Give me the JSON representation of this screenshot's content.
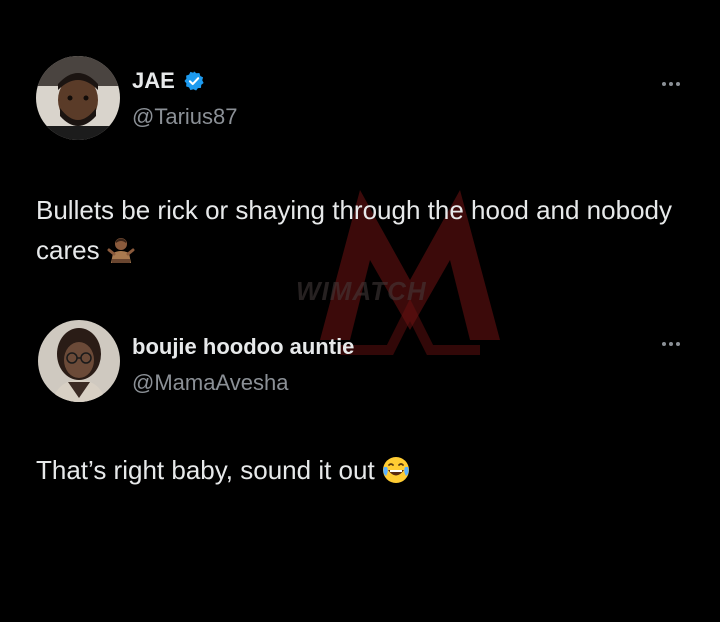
{
  "watermark": {
    "text": "WIMATCH"
  },
  "tweets": [
    {
      "display_name": "JAE",
      "handle": "@Tarius87",
      "text": "Bullets be rick or shaying through the hood and nobody cares",
      "verified": true,
      "emoji": "person-shrugging-emoji"
    },
    {
      "display_name": "boujie hoodoo auntie",
      "handle": "@MamaAvesha",
      "text": "That’s right baby, sound it out",
      "verified": false,
      "emoji": "face-with-tears-of-joy-emoji"
    }
  ],
  "colors": {
    "background": "#000000",
    "primary_text": "#e7e9ea",
    "secondary_text": "#8b9096",
    "verified_blue": "#1d9bf0",
    "watermark_red": "#7a1111"
  }
}
